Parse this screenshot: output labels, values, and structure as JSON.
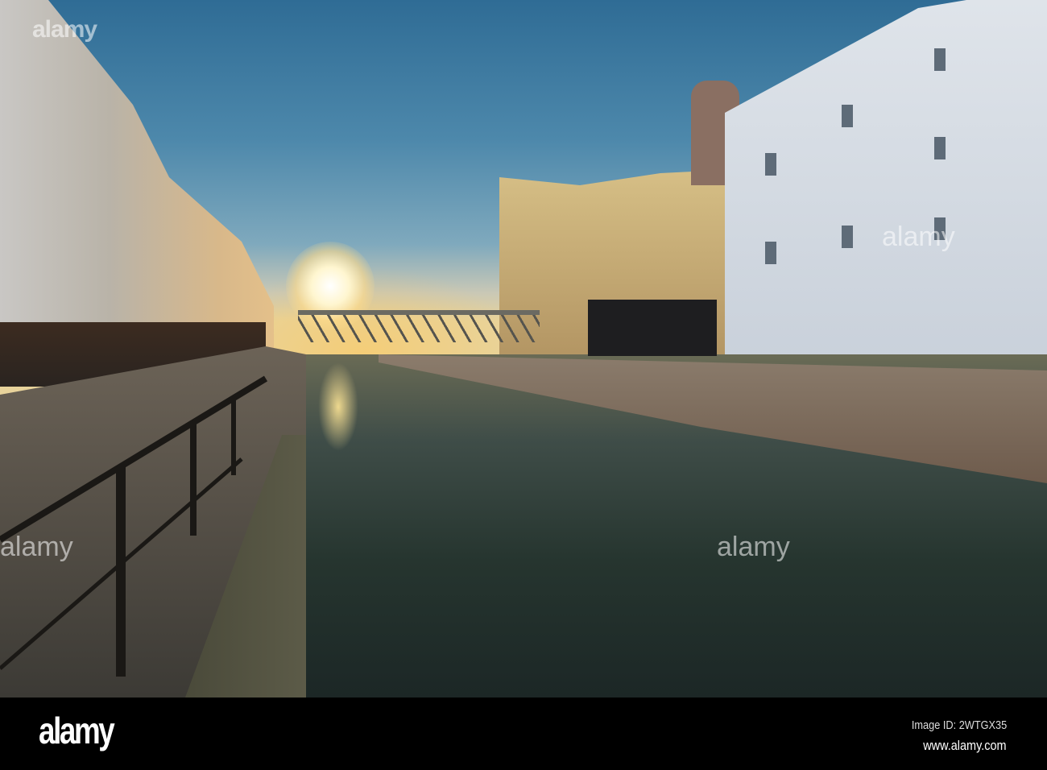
{
  "photo": {
    "subject": "canal at sunset with buildings and bridge",
    "watermark_text": "alamy"
  },
  "footer": {
    "logo": "alamy",
    "image_id": "Image ID: 2WTGX35",
    "url": "www.alamy.com"
  }
}
